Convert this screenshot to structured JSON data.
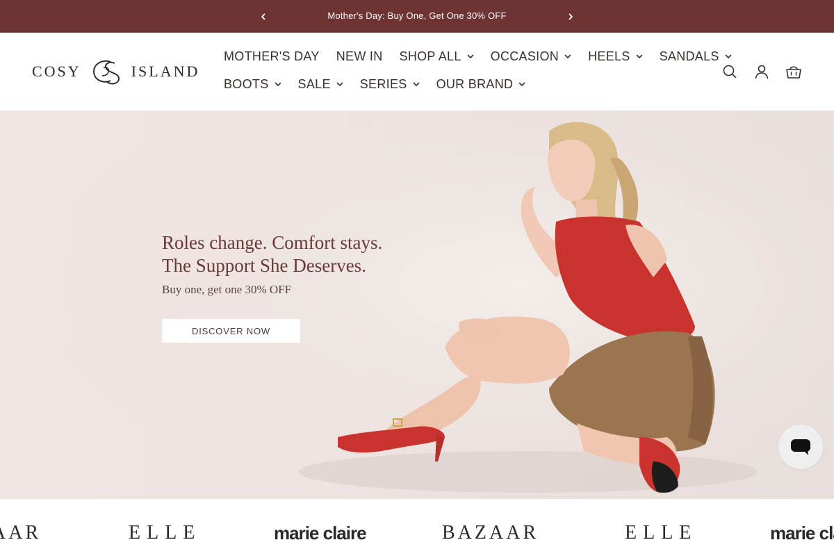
{
  "announcement": {
    "message": "Mother's Day: Buy One, Get One 30% OFF",
    "prev_icon": "chevron-left-icon",
    "next_icon": "chevron-right-icon"
  },
  "brand": {
    "logo_left": "COSY",
    "logo_right": "ISLAND",
    "logo_alt": "Cosy Island"
  },
  "nav": {
    "row1": [
      {
        "label": "MOTHER'S DAY",
        "has_dropdown": false
      },
      {
        "label": "NEW IN",
        "has_dropdown": false
      },
      {
        "label": "SHOP ALL",
        "has_dropdown": true
      },
      {
        "label": "OCCASION",
        "has_dropdown": true
      },
      {
        "label": "HEELS",
        "has_dropdown": true
      },
      {
        "label": "SANDALS",
        "has_dropdown": true
      }
    ],
    "row2": [
      {
        "label": "BOOTS",
        "has_dropdown": true
      },
      {
        "label": "SALE",
        "has_dropdown": true
      },
      {
        "label": "SERIES",
        "has_dropdown": true
      },
      {
        "label": "OUR BRAND",
        "has_dropdown": true
      }
    ]
  },
  "header_tools": [
    "search-icon",
    "account-icon",
    "cart-icon"
  ],
  "hero": {
    "title_line1": "Roles change. Comfort stays.",
    "title_line2": "The Support She Deserves.",
    "subtitle": "Buy one, get one 30% OFF",
    "button_label": "DISCOVER NOW"
  },
  "press": {
    "logos": [
      "BAZAAR",
      "ELLE",
      "marie claire",
      "BAZAAR",
      "ELLE",
      "marie claire"
    ]
  },
  "chat": {
    "icon": "chat-bubble-icon"
  },
  "colors": {
    "announcement_bg": "#6e3434",
    "hero_text": "#6a3838",
    "hero_bg": "#eee4e1",
    "accent_red": "#c8332d"
  }
}
